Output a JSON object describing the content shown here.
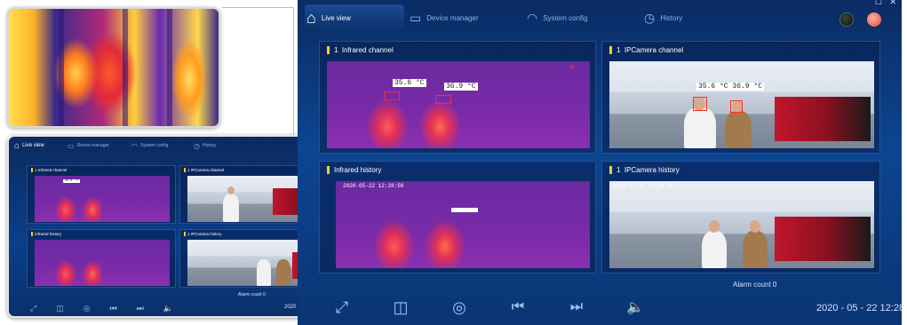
{
  "colors": {
    "accent": "#f5d21a",
    "window_bg": "#0c4590",
    "alert": "#ff2a2a"
  },
  "app": {
    "tabs": [
      {
        "label": "Live view",
        "icon": "home-icon"
      },
      {
        "label": "Device manager",
        "icon": "monitor-icon"
      },
      {
        "label": "System config",
        "icon": "gauge-icon"
      },
      {
        "label": "History",
        "icon": "history-icon"
      }
    ],
    "window_controls": {
      "maximize": "☐",
      "close": "✕"
    },
    "panels": [
      {
        "number": "1",
        "title": "Infrared channel"
      },
      {
        "number": "1",
        "title": "IPCamera channel"
      },
      {
        "number": "",
        "title": "Infrared history"
      },
      {
        "number": "1",
        "title": "IPCamera history"
      }
    ],
    "temps": {
      "left": "35.6 °C",
      "right": "36.9 °C",
      "overlay": "35.6 °C 36.9 °C"
    },
    "timestamps": {
      "ir_history": "2020-05-22 12:28:50",
      "cam_history": "2020-05-22 12:28:50"
    },
    "alarm": "Alarm count 0",
    "datetime": "2020 - 05 - 22  12:28"
  },
  "icons": [
    "expand-icon",
    "split-view-icon",
    "camera-icon",
    "skip-back-icon",
    "skip-forward-icon",
    "volume-icon"
  ]
}
